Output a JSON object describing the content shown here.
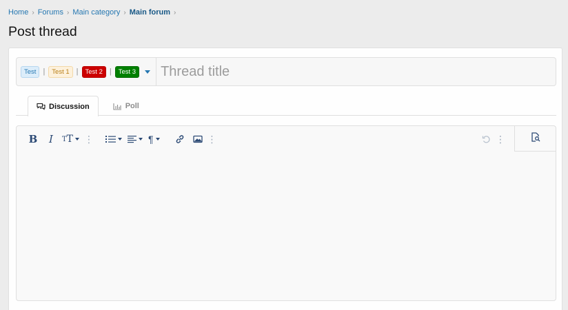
{
  "breadcrumb": {
    "items": [
      "Home",
      "Forums",
      "Main category"
    ],
    "current": "Main forum",
    "separator": "›"
  },
  "page": {
    "title": "Post thread"
  },
  "thread": {
    "prefixes": [
      "Test",
      "Test 1",
      "Test 2",
      "Test 3"
    ],
    "prefix_separator": "|",
    "title_placeholder": "Thread title"
  },
  "tabs": [
    {
      "label": "Discussion",
      "icon": "comments-icon",
      "active": true
    },
    {
      "label": "Poll",
      "icon": "bar-chart-icon",
      "active": false
    }
  ],
  "editor": {
    "toolbar": [
      "bold",
      "italic",
      "font-size",
      "more",
      "list",
      "align",
      "paragraph",
      "link",
      "image",
      "more"
    ],
    "right_tools": [
      "undo",
      "more",
      "preview"
    ],
    "content": ""
  },
  "colors": {
    "link": "#2577b1",
    "toolbar_icon": "#2c4a75",
    "prefix_red": "#cc0000",
    "prefix_green": "#008000"
  }
}
